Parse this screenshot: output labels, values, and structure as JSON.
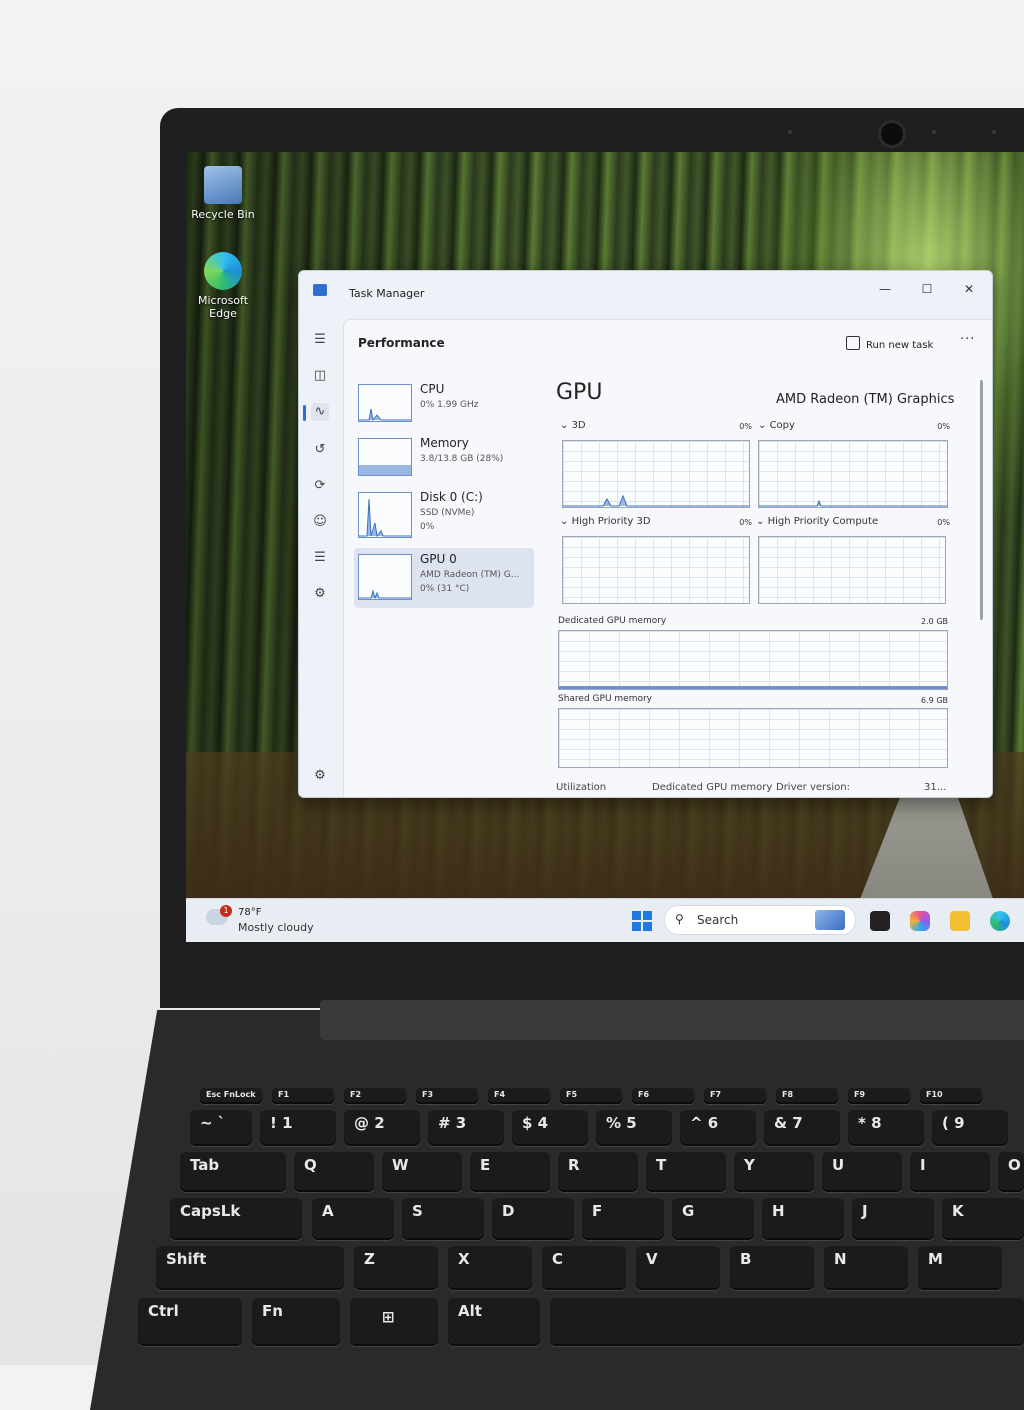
{
  "desktop": {
    "icons": [
      {
        "label": "Recycle Bin"
      },
      {
        "label": "Microsoft Edge"
      }
    ]
  },
  "task_manager": {
    "title": "Task Manager",
    "window_controls": {
      "minimize": "—",
      "maximize": "☐",
      "close": "✕"
    },
    "page_title": "Performance",
    "run_new_task": "Run new task",
    "more": "···",
    "resources": [
      {
        "name": "CPU",
        "line1": "0%  1.99 GHz",
        "line2": ""
      },
      {
        "name": "Memory",
        "line1": "3.8/13.8 GB (28%)",
        "line2": ""
      },
      {
        "name": "Disk 0 (C:)",
        "line1": "SSD (NVMe)",
        "line2": "0%"
      },
      {
        "name": "GPU 0",
        "line1": "AMD Radeon (TM) G...",
        "line2": "0%  (31 °C)"
      }
    ],
    "gpu": {
      "heading": "GPU",
      "model": "AMD Radeon (TM) Graphics",
      "engines": [
        {
          "label": "3D",
          "value": "0%"
        },
        {
          "label": "Copy",
          "value": "0%"
        },
        {
          "label": "High Priority 3D",
          "value": "0%"
        },
        {
          "label": "High Priority Compute",
          "value": "0%"
        }
      ],
      "dedicated_label": "Dedicated GPU memory",
      "dedicated_max": "2.0 GB",
      "shared_label": "Shared GPU memory",
      "shared_max": "6.9 GB",
      "footer": {
        "utilization": "Utilization",
        "dedicated": "Dedicated GPU memory",
        "driver": "Driver version:",
        "driver_value": "31..."
      }
    }
  },
  "taskbar": {
    "weather_badge": "1",
    "temperature": "78°F",
    "condition": "Mostly cloudy",
    "search_placeholder": "Search"
  },
  "keyboard": {
    "fn_row": [
      "Esc FnLock",
      "F1",
      "F2",
      "F3",
      "F4",
      "F5",
      "F6",
      "F7",
      "F8",
      "F9",
      "F10"
    ],
    "number_row": [
      "~ `",
      "! 1",
      "@ 2",
      "# 3",
      "$ 4",
      "% 5",
      "^ 6",
      "& 7",
      "* 8",
      "( 9"
    ],
    "row_q": [
      "Tab",
      "Q",
      "W",
      "E",
      "R",
      "T",
      "Y",
      "U",
      "I",
      "O"
    ],
    "row_a": [
      "CapsLk",
      "A",
      "S",
      "D",
      "F",
      "G",
      "H",
      "J",
      "K"
    ],
    "row_z": [
      "Shift",
      "Z",
      "X",
      "C",
      "V",
      "B",
      "N",
      "M"
    ],
    "row_bottom": [
      "Ctrl",
      "Fn",
      "⊞",
      "Alt"
    ]
  }
}
